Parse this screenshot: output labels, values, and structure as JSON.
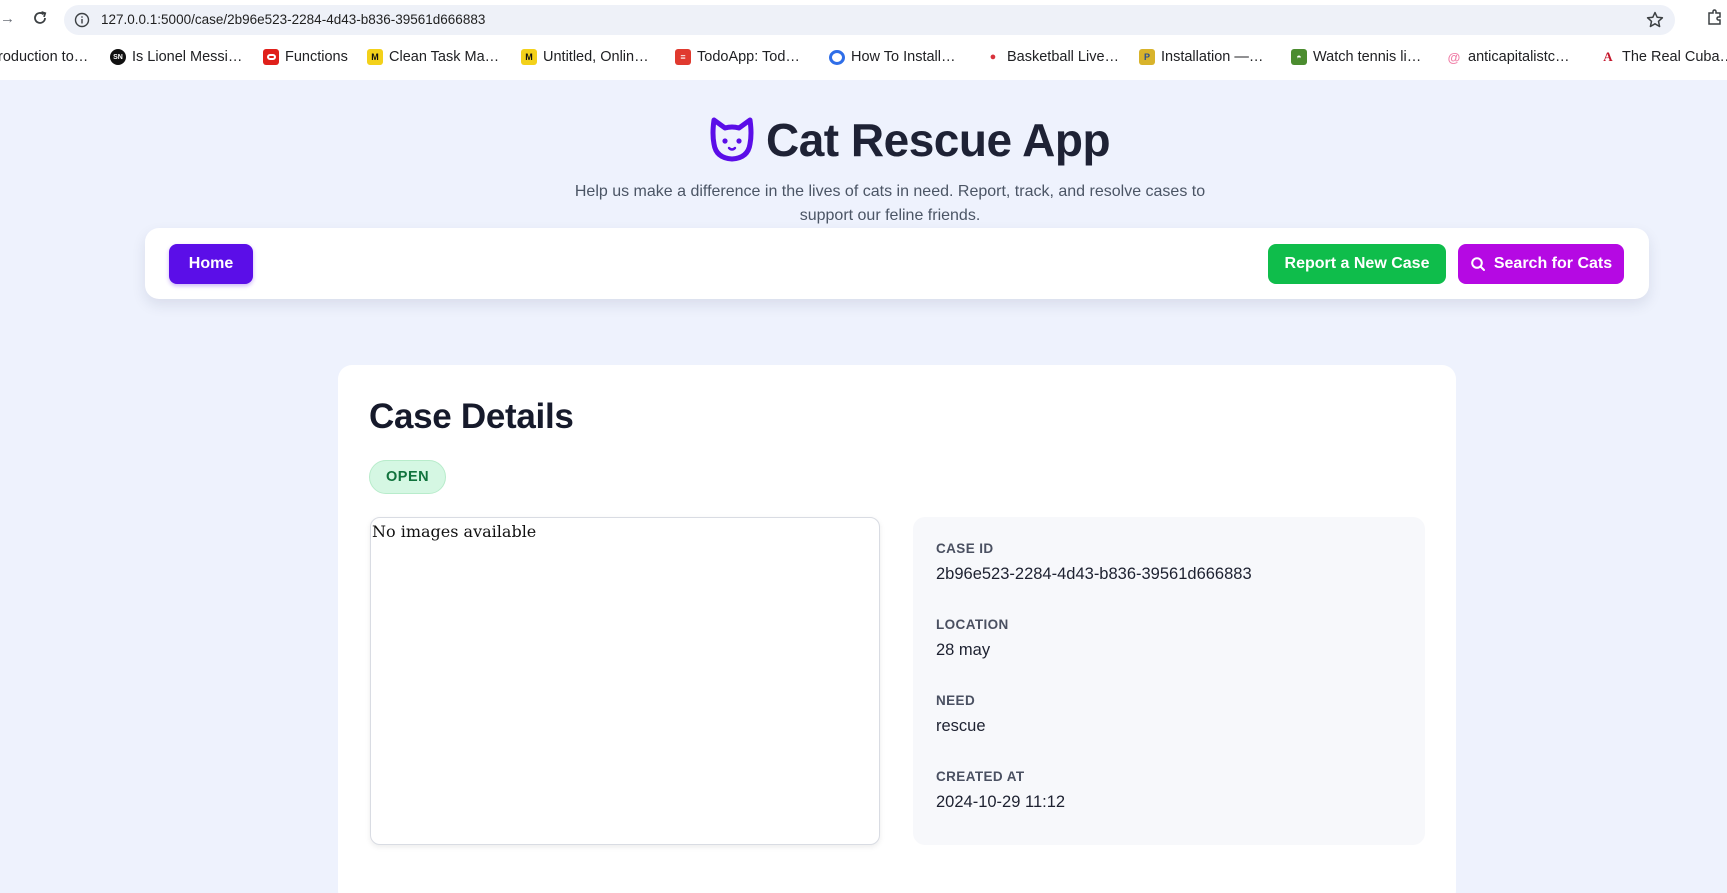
{
  "browser": {
    "url": "127.0.0.1:5000/case/2b96e523-2284-4d43-b836-39561d666883",
    "bookmarks": [
      {
        "label": "roduction to…",
        "icon": "none"
      },
      {
        "label": "Is Lionel Messi…",
        "icon": "sn-icon",
        "color": "#111111"
      },
      {
        "label": "Functions",
        "icon": "oracle-icon",
        "color": "#e0201b"
      },
      {
        "label": "Clean Task Ma…",
        "icon": "m-icon",
        "color": "#f3d11a"
      },
      {
        "label": "Untitled, Onlin…",
        "icon": "m-icon",
        "color": "#f3d11a"
      },
      {
        "label": "TodoApp: Tod…",
        "icon": "todoist-icon",
        "color": "#e03a2f"
      },
      {
        "label": "How To Install…",
        "icon": "digitalocean-icon",
        "color": "#2f6ee8"
      },
      {
        "label": "Basketball Live…",
        "icon": "ball-icon",
        "color": "#d8323c"
      },
      {
        "label": "Installation —…",
        "icon": "python-icon",
        "color": "#d8b32b"
      },
      {
        "label": "Watch tennis li…",
        "icon": "tennis-icon",
        "color": "#4b8c2f"
      },
      {
        "label": "anticapitalistc…",
        "icon": "swirl-icon",
        "color": "#f07ea7"
      },
      {
        "label": "The Real Cuba…",
        "icon": "a-icon",
        "color": "#c4152a"
      }
    ]
  },
  "header": {
    "title": "Cat Rescue App",
    "subtitle": "Help us make a difference in the lives of cats in need. Report, track, and resolve cases to support our feline friends."
  },
  "nav": {
    "home": "Home",
    "report": "Report a New Case",
    "search": "Search for Cats"
  },
  "case": {
    "heading": "Case Details",
    "status": "OPEN",
    "images_text": "No images available",
    "fields": {
      "case_id_label": "CASE ID",
      "case_id": "2b96e523-2284-4d43-b836-39561d666883",
      "location_label": "LOCATION",
      "location": "28 may",
      "need_label": "NEED",
      "need": "rescue",
      "created_label": "CREATED AT",
      "created": "2024-10-29 11:12"
    }
  },
  "colors": {
    "primary": "#5b0ee8",
    "success": "#0fbd4b",
    "accent": "#b509e3",
    "background": "#eef2fd"
  }
}
